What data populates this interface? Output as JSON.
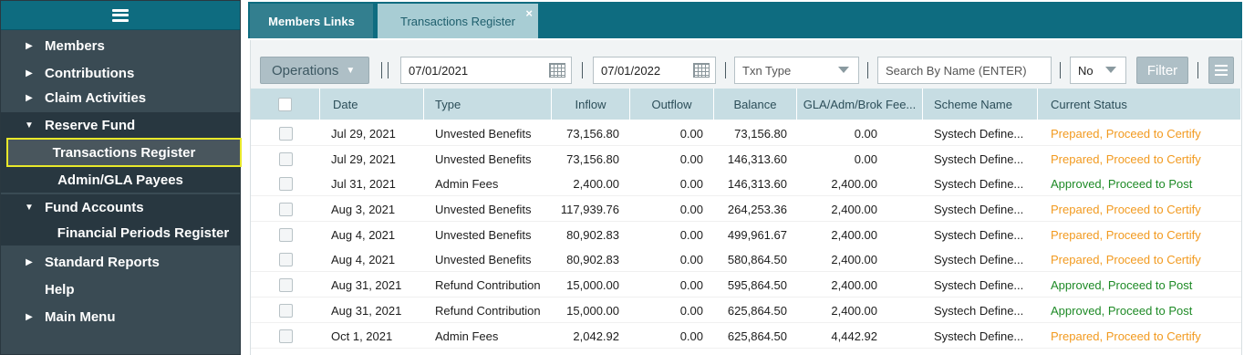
{
  "sidebar": {
    "items": [
      {
        "label": "Members",
        "expanded": false
      },
      {
        "label": "Contributions",
        "expanded": false
      },
      {
        "label": "Claim Activities",
        "expanded": false
      },
      {
        "label": "Reserve Fund",
        "expanded": true
      },
      {
        "label": "Transactions Register",
        "selected": true
      },
      {
        "label": "Admin/GLA Payees"
      },
      {
        "label": "Fund Accounts",
        "expanded": true
      },
      {
        "label": "Financial Periods Register"
      },
      {
        "label": "Standard Reports",
        "expanded": false
      },
      {
        "label": "Help"
      },
      {
        "label": "Main Menu",
        "expanded": false
      }
    ]
  },
  "tabs": [
    {
      "label": "Members Links",
      "active": false
    },
    {
      "label": "Transactions Register",
      "active": true,
      "close": "×"
    }
  ],
  "toolbar": {
    "operations_label": "Operations",
    "date_from": "07/01/2021",
    "date_to": "07/01/2022",
    "txn_type_placeholder": "Txn Type",
    "search_placeholder": "Search By Name (ENTER)",
    "no_value": "No",
    "filter_label": "Filter"
  },
  "grid": {
    "headers": [
      "Date",
      "Type",
      "Inflow",
      "Outflow",
      "Balance",
      "GLA/Adm/Brok Fee...",
      "Scheme Name",
      "Current Status"
    ],
    "rows": [
      {
        "date": "Jul 29, 2021",
        "type": "Unvested Benefits",
        "inflow": "73,156.80",
        "outflow": "0.00",
        "balance": "73,156.80",
        "fee": "0.00",
        "scheme": "Systech Define...",
        "status": "Prepared, Proceed to Certify",
        "status_kind": "prepared"
      },
      {
        "date": "Jul 29, 2021",
        "type": "Unvested Benefits",
        "inflow": "73,156.80",
        "outflow": "0.00",
        "balance": "146,313.60",
        "fee": "0.00",
        "scheme": "Systech Define...",
        "status": "Prepared, Proceed to Certify",
        "status_kind": "prepared"
      },
      {
        "date": "Jul 31, 2021",
        "type": "Admin Fees",
        "inflow": "2,400.00",
        "outflow": "0.00",
        "balance": "146,313.60",
        "fee": "2,400.00",
        "scheme": "Systech Define...",
        "status": "Approved, Proceed to Post",
        "status_kind": "approved"
      },
      {
        "date": "Aug 3, 2021",
        "type": "Unvested Benefits",
        "inflow": "117,939.76",
        "outflow": "0.00",
        "balance": "264,253.36",
        "fee": "2,400.00",
        "scheme": "Systech Define...",
        "status": "Prepared, Proceed to Certify",
        "status_kind": "prepared"
      },
      {
        "date": "Aug 4, 2021",
        "type": "Unvested Benefits",
        "inflow": "80,902.83",
        "outflow": "0.00",
        "balance": "499,961.67",
        "fee": "2,400.00",
        "scheme": "Systech Define...",
        "status": "Prepared, Proceed to Certify",
        "status_kind": "prepared"
      },
      {
        "date": "Aug 4, 2021",
        "type": "Unvested Benefits",
        "inflow": "80,902.83",
        "outflow": "0.00",
        "balance": "580,864.50",
        "fee": "2,400.00",
        "scheme": "Systech Define...",
        "status": "Prepared, Proceed to Certify",
        "status_kind": "prepared"
      },
      {
        "date": "Aug 31, 2021",
        "type": "Refund Contribution",
        "inflow": "15,000.00",
        "outflow": "0.00",
        "balance": "595,864.50",
        "fee": "2,400.00",
        "scheme": "Systech Define...",
        "status": "Approved, Proceed to Post",
        "status_kind": "approved"
      },
      {
        "date": "Aug 31, 2021",
        "type": "Refund Contribution",
        "inflow": "15,000.00",
        "outflow": "0.00",
        "balance": "625,864.50",
        "fee": "2,400.00",
        "scheme": "Systech Define...",
        "status": "Approved, Proceed to Post",
        "status_kind": "approved"
      },
      {
        "date": "Oct 1, 2021",
        "type": "Admin Fees",
        "inflow": "2,042.92",
        "outflow": "0.00",
        "balance": "625,864.50",
        "fee": "4,442.92",
        "scheme": "Systech Define...",
        "status": "Prepared, Proceed to Certify",
        "status_kind": "prepared"
      }
    ]
  },
  "colors": {
    "teal": "#0e6c80",
    "sidebar": "#3a4b54",
    "prepared": "#f29a1f",
    "approved": "#1e8a26",
    "highlight": "#e8e82a"
  }
}
